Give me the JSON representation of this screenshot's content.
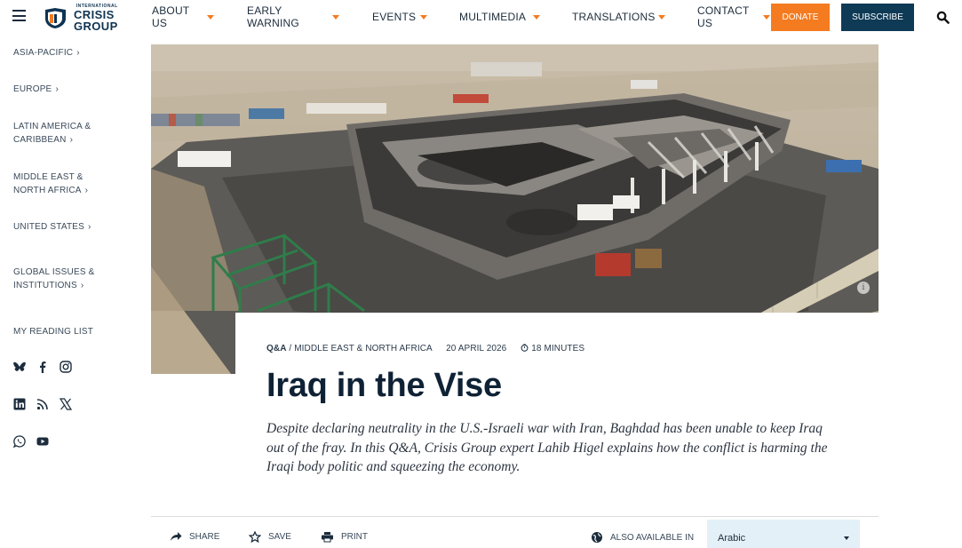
{
  "brand": {
    "small_text": "INTERNATIONAL",
    "name_line1": "CRISIS",
    "name_line2": "GROUP",
    "accent": "#f47b20",
    "navy": "#0e3a56"
  },
  "nav": {
    "items": [
      {
        "line1": "ABOUT",
        "line2": "US"
      },
      {
        "line1": "EARLY",
        "line2": "WARNING"
      },
      {
        "line1": "EVENTS",
        "line2": ""
      },
      {
        "line1": "MULTIMEDIA",
        "line2": ""
      },
      {
        "line1": "TRANSLATIONS",
        "line2": ""
      },
      {
        "line1": "CONTACT",
        "line2": "US"
      }
    ],
    "donate": "DONATE",
    "subscribe": "SUBSCRIBE",
    "icons": [
      "menu-icon",
      "search-icon"
    ]
  },
  "sidebar": {
    "items": [
      {
        "line1": "ASIA-PACIFIC",
        "line2": ""
      },
      {
        "line1": "EUROPE",
        "line2": ""
      },
      {
        "line1": "LATIN AMERICA &",
        "line2": "CARIBBEAN"
      },
      {
        "line1": "MIDDLE EAST &",
        "line2": "NORTH AFRICA"
      },
      {
        "line1": "UNITED STATES",
        "line2": ""
      },
      {
        "line1": "GLOBAL ISSUES &",
        "line2": "INSTITUTIONS"
      }
    ],
    "reading_list": "MY READING LIST",
    "social_icons": [
      "bluesky-icon",
      "facebook-icon",
      "instagram-icon",
      "linkedin-icon",
      "rss-icon",
      "x-icon",
      "whatsapp-icon",
      "youtube-icon"
    ]
  },
  "article": {
    "type": "Q&A",
    "separator": "/",
    "region": "MIDDLE EAST & NORTH AFRICA",
    "date": "20 APRIL 2026",
    "read_time": "18 MINUTES",
    "title": "Iraq in the Vise",
    "summary": "Despite declaring neutrality in the U.S.-Israeli war with Iran, Baghdad has been unable to keep Iraq out of the fray. In this Q&A, Crisis Group expert Lahib Higel explains how the conflict is harming the Iraqi body politic and squeezing the economy."
  },
  "toolbar": {
    "share": "SHARE",
    "save": "SAVE",
    "print": "PRINT",
    "also_available": "ALSO AVAILABLE IN",
    "language": "Arabic"
  },
  "hero": {
    "info_glyph": "i"
  }
}
